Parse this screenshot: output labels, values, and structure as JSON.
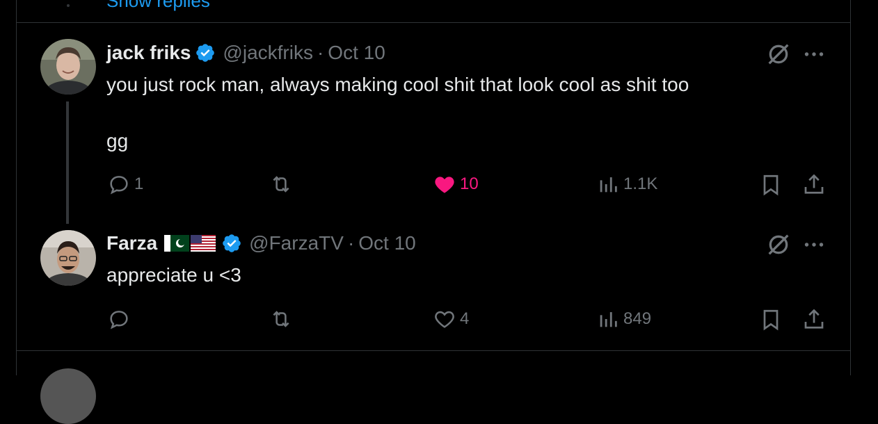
{
  "show_replies": "Show replies",
  "tweets": [
    {
      "name": "jack friks",
      "handle": "@jackfriks",
      "separator": "·",
      "date": "Oct 10",
      "text_line1": "you just rock man, always making cool shit that look cool as shit too",
      "text_line2": "gg",
      "replies": "1",
      "likes": "10",
      "views": "1.1K",
      "liked": true
    },
    {
      "name": "Farza",
      "handle": "@FarzaTV",
      "separator": "·",
      "date": "Oct 10",
      "text_line1": "appreciate u <3",
      "replies": "",
      "likes": "4",
      "views": "849",
      "liked": false
    }
  ],
  "colors": {
    "accent": "#1d9bf0",
    "like": "#f91880",
    "muted": "#71767b",
    "text": "#e7e9ea",
    "border": "#2f3336"
  },
  "icons": [
    "reply-icon",
    "retweet-icon",
    "heart-icon",
    "views-icon",
    "bookmark-icon",
    "share-icon",
    "grok-icon",
    "more-icon",
    "verified-icon"
  ]
}
